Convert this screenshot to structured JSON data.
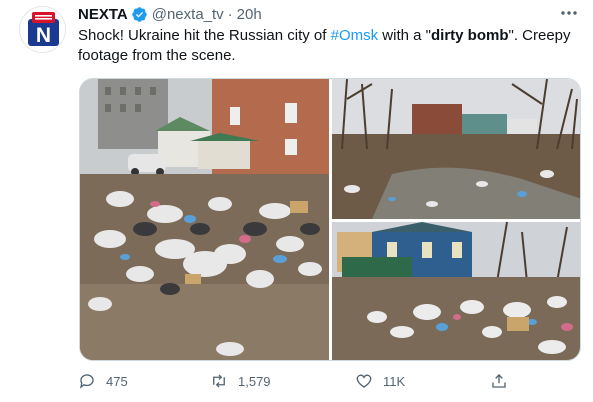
{
  "tweet": {
    "author": {
      "name": "NEXTA",
      "handle": "@nexta_tv",
      "avatar_letter": "N",
      "accent": "#d7142c"
    },
    "separator": "·",
    "time": "20h",
    "text": {
      "part1": "Shock! Ukraine hit the Russian city of ",
      "hashtag": "#Omsk",
      "part2": " with a \"",
      "bold": "dirty bomb",
      "part3": "\". Creepy footage from the scene."
    },
    "icons": {
      "verified": "verified-badge-icon",
      "more": "more-icon",
      "reply": "reply-icon",
      "retweet": "retweet-icon",
      "like": "heart-icon",
      "share": "share-icon"
    },
    "stats": {
      "replies": "475",
      "retweets": "1,579",
      "likes": "11K"
    },
    "colors": {
      "link": "#1d9bf0",
      "verified": "#1d9bf0",
      "muted": "#536471"
    }
  }
}
